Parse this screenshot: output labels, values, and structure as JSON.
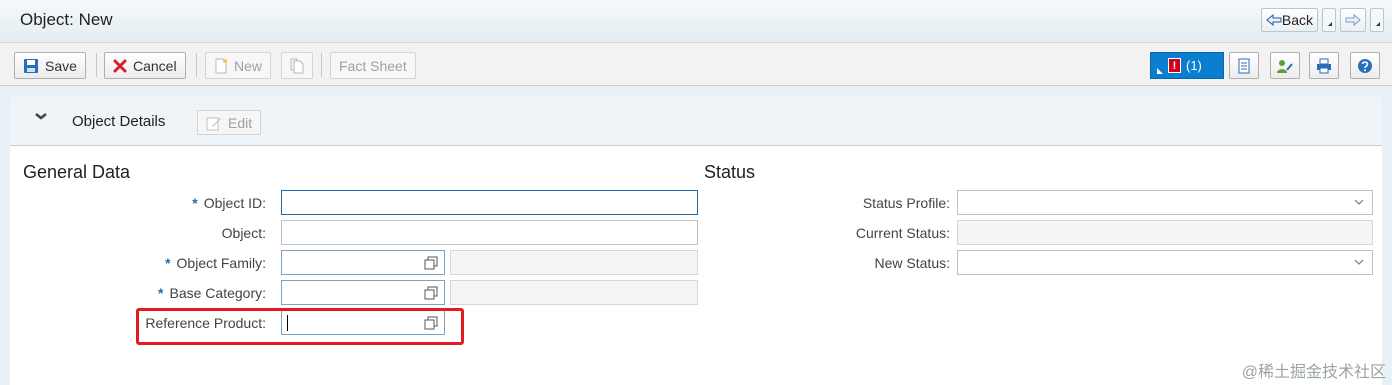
{
  "window": {
    "title": "Object: New"
  },
  "nav": {
    "back_label": "Back"
  },
  "toolbar": {
    "save_label": "Save",
    "cancel_label": "Cancel",
    "new_label": "New",
    "fact_sheet_label": "Fact Sheet",
    "messages_count": "(1)",
    "messages_error_glyph": "!"
  },
  "section": {
    "title": "Object Details",
    "edit_label": "Edit"
  },
  "general_data": {
    "title": "General Data",
    "required_marker": "*",
    "object_id_label": "Object ID:",
    "object_label": "Object:",
    "object_family_label": "Object Family:",
    "base_category_label": "Base Category:",
    "reference_product_label": "Reference Product:"
  },
  "status": {
    "title": "Status",
    "status_profile_label": "Status Profile:",
    "current_status_label": "Current Status:",
    "new_status_label": "New Status:"
  },
  "watermark": "@稀土掘金技术社区",
  "colors": {
    "accent": "#0a7fd0",
    "error": "#d0021b",
    "highlight": "#e31b23"
  }
}
